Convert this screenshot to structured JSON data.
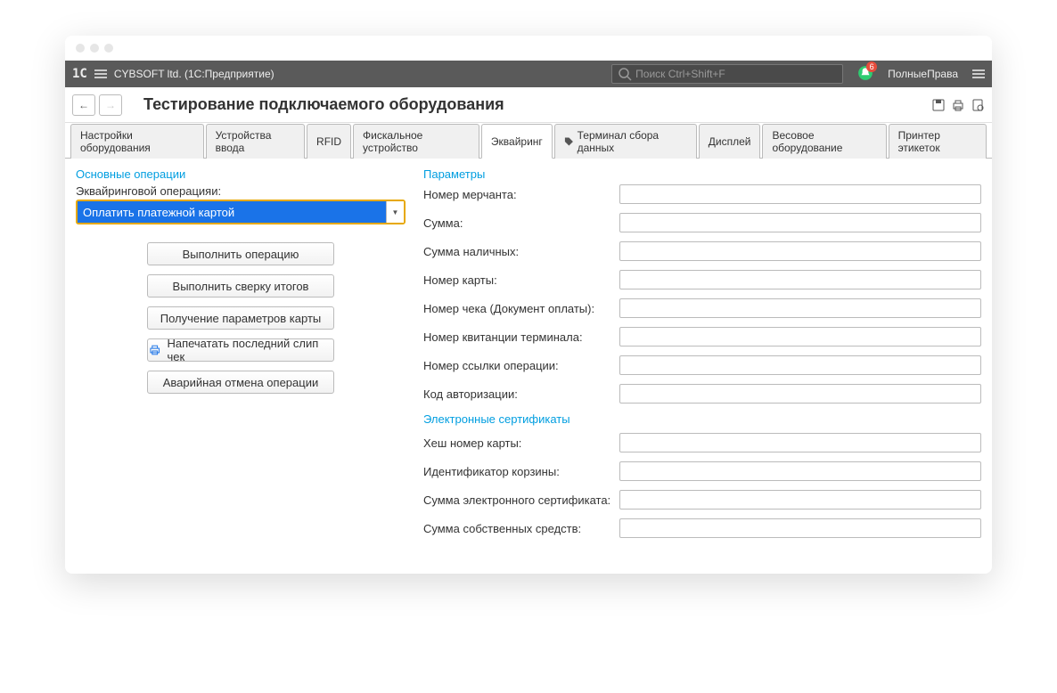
{
  "topbar": {
    "title": "CYBSOFT ltd.  (1С:Предприятие)",
    "search_placeholder": "Поиск Ctrl+Shift+F",
    "notification_count": "6",
    "user": "ПолныеПрава"
  },
  "toolbar": {
    "page_title": "Тестирование подключаемого оборудования"
  },
  "tabs": [
    {
      "label": "Настройки оборудования"
    },
    {
      "label": "Устройства ввода"
    },
    {
      "label": "RFID"
    },
    {
      "label": "Фискальное устройство"
    },
    {
      "label": "Эквайринг"
    },
    {
      "label": "Терминал сбора данных"
    },
    {
      "label": "Дисплей"
    },
    {
      "label": "Весовое оборудование"
    },
    {
      "label": "Принтер этикеток"
    }
  ],
  "left": {
    "section_title": "Основные операции",
    "operation_label": "Эквайринговой операцияи:",
    "operation_value": "Оплатить платежной картой",
    "buttons": {
      "execute": "Выполнить операцию",
      "reconcile": "Выполнить сверку итогов",
      "get_params": "Получение параметров карты",
      "print_slip": "Напечатать последний слип чек",
      "emergency_cancel": "Аварийная отмена операции"
    }
  },
  "right": {
    "section_title": "Параметры",
    "fields": {
      "merchant": "Номер мерчанта:",
      "amount": "Сумма:",
      "cash_amount": "Сумма наличных:",
      "card_number": "Номер карты:",
      "check_number": "Номер чека (Документ оплаты):",
      "terminal_receipt": "Номер квитанции терминала:",
      "operation_ref": "Номер ссылки операции:",
      "auth_code": "Код авторизации:"
    },
    "cert_title": "Электронные сертификаты",
    "cert_fields": {
      "card_hash": "Хеш номер карты:",
      "basket_id": "Идентификатор корзины:",
      "cert_amount": "Сумма электронного сертификата:",
      "own_funds": "Сумма собственных средств:"
    }
  }
}
